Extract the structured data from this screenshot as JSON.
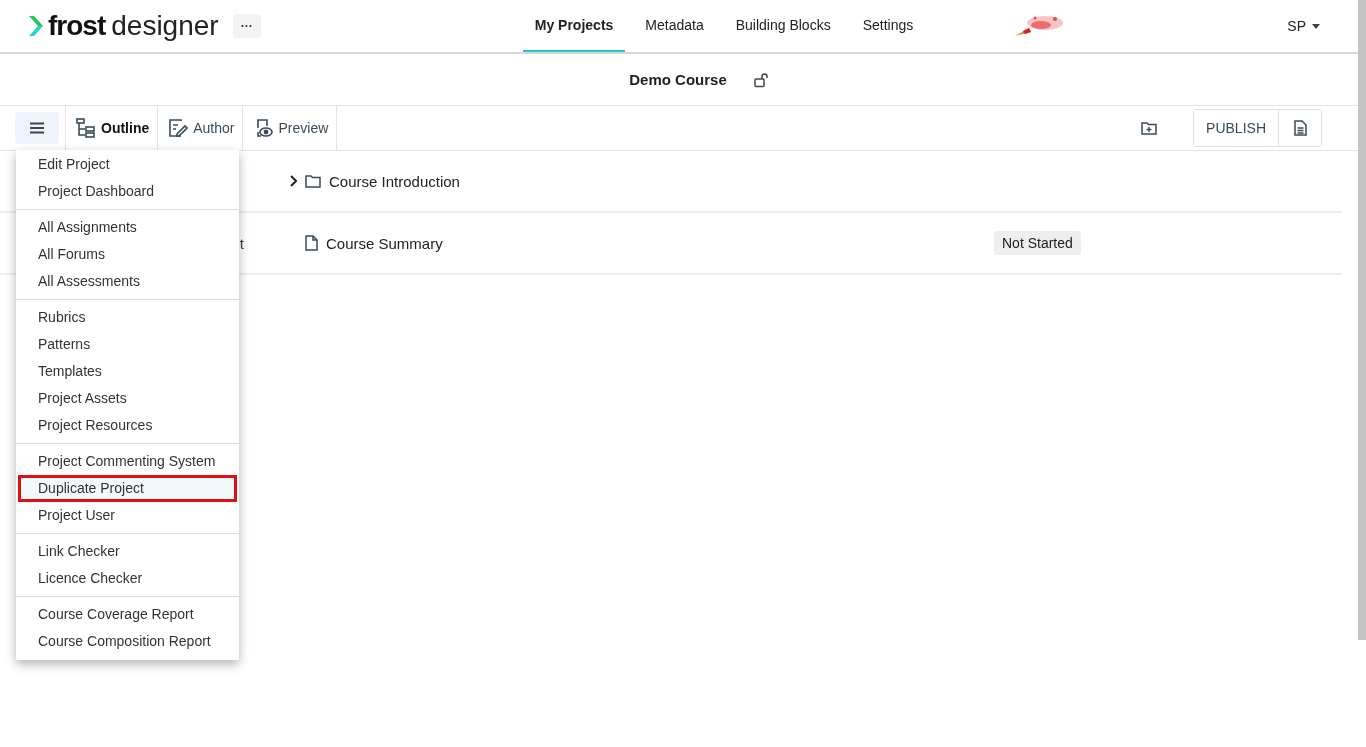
{
  "header": {
    "logo": {
      "bold": "frost",
      "light": "designer"
    },
    "more_button": "···",
    "nav": [
      {
        "label": "My Projects",
        "selected": true
      },
      {
        "label": "Metadata",
        "selected": false
      },
      {
        "label": "Building Blocks",
        "selected": false
      },
      {
        "label": "Settings",
        "selected": false
      }
    ],
    "user": "SP"
  },
  "project": {
    "title": "Demo Course",
    "locked": false
  },
  "toolbar": {
    "tabs": [
      {
        "label": "Outline",
        "selected": true,
        "kind": "outline"
      },
      {
        "label": "Author",
        "selected": false,
        "kind": "author"
      },
      {
        "label": "Preview",
        "selected": false,
        "kind": "preview"
      }
    ],
    "publish": "PUBLISH"
  },
  "outline": [
    {
      "kind": "folder",
      "title": "Course Introduction",
      "expanded": false
    },
    {
      "kind": "page",
      "title": "Course Summary",
      "column_1": "t",
      "status": "Not Started"
    }
  ],
  "menu": {
    "groups": [
      {
        "items": [
          {
            "label": "Edit Project",
            "highlighted": false
          },
          {
            "label": "Project Dashboard",
            "highlighted": false
          }
        ]
      },
      {
        "items": [
          {
            "label": "All Assignments",
            "highlighted": false
          },
          {
            "label": "All Forums",
            "highlighted": false
          },
          {
            "label": "All Assessments",
            "highlighted": false
          }
        ]
      },
      {
        "items": [
          {
            "label": "Rubrics",
            "highlighted": false
          },
          {
            "label": "Patterns",
            "highlighted": false
          },
          {
            "label": "Templates",
            "highlighted": false
          },
          {
            "label": "Project Assets",
            "highlighted": false
          },
          {
            "label": "Project Resources",
            "highlighted": false
          }
        ]
      },
      {
        "items": [
          {
            "label": "Project Commenting System",
            "highlighted": false
          },
          {
            "label": "Duplicate Project",
            "highlighted": true
          },
          {
            "label": "Project User",
            "highlighted": false
          }
        ]
      },
      {
        "items": [
          {
            "label": "Link Checker",
            "highlighted": false
          },
          {
            "label": "Licence Checker",
            "highlighted": false
          }
        ]
      },
      {
        "items": [
          {
            "label": "Course Coverage Report",
            "highlighted": false
          },
          {
            "label": "Course Composition Report",
            "highlighted": false
          }
        ]
      }
    ]
  }
}
